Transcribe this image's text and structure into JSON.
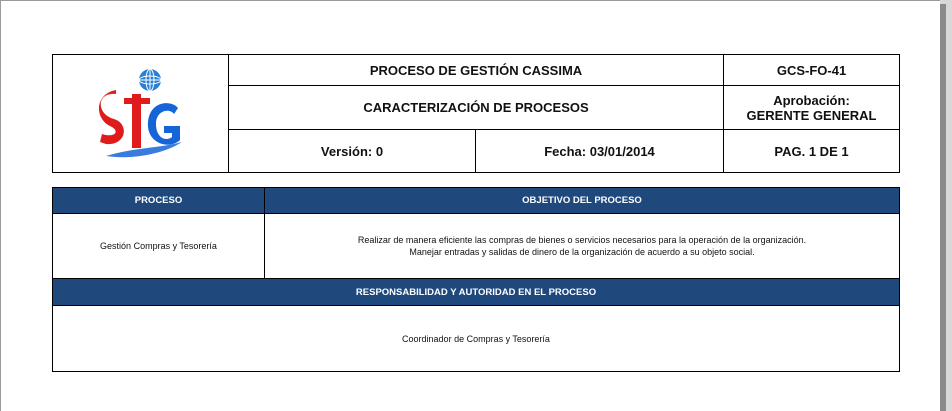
{
  "header": {
    "title": "PROCESO DE GESTIÓN CASSIMA",
    "code": "GCS-FO-41",
    "subtitle": "CARACTERIZACIÓN DE PROCESOS",
    "approval_label": "Aprobación:",
    "approval_value": "GERENTE GENERAL",
    "version": "Versión: 0",
    "date": "Fecha: 03/01/2014",
    "page": "PAG. 1 DE 1"
  },
  "logo": {
    "icon": "sig-globe-logo",
    "colors": {
      "red": "#e01b1b",
      "blue": "#1565d8",
      "globe": "#2a7fd4"
    }
  },
  "process_section": {
    "process_header": "PROCESO",
    "objective_header": "OBJETIVO DEL PROCESO",
    "process_name": "Gestión Compras y Tesorería",
    "objective_lines": [
      "Realizar de manera eficiente las compras de bienes o servicios necesarios para la operación de la organización.",
      "Manejar entradas y salidas de dinero de la organización de acuerdo a su objeto social."
    ]
  },
  "responsibility_section": {
    "header": "RESPONSABILIDAD Y AUTORIDAD EN EL PROCESO",
    "value": "Coordinador de Compras y Tesorería"
  },
  "colors": {
    "header_blue": "#1f497d",
    "page_background": "#ffffff",
    "viewer_background": "#d8d8d8"
  }
}
